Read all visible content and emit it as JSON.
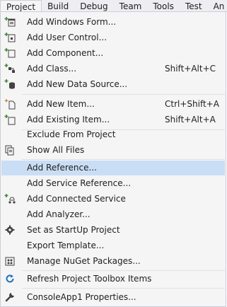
{
  "menubar": {
    "items": [
      {
        "label": "Project"
      },
      {
        "label": "Build"
      },
      {
        "label": "Debug"
      },
      {
        "label": "Team"
      },
      {
        "label": "Tools"
      },
      {
        "label": "Test"
      },
      {
        "label": "An"
      }
    ]
  },
  "menu": {
    "items": [
      {
        "label": "Add Windows Form...",
        "shortcut": "",
        "icon": "add-windows-form-icon"
      },
      {
        "label": "Add User Control...",
        "shortcut": "",
        "icon": "add-user-control-icon"
      },
      {
        "label": "Add Component...",
        "shortcut": "",
        "icon": "add-component-icon"
      },
      {
        "label": "Add Class...",
        "shortcut": "Shift+Alt+C",
        "icon": "add-class-icon"
      },
      {
        "label": "Add New Data Source...",
        "shortcut": "",
        "icon": "add-data-source-icon"
      },
      {
        "label": "Add New Item...",
        "shortcut": "Ctrl+Shift+A",
        "icon": "add-new-item-icon"
      },
      {
        "label": "Add Existing Item...",
        "shortcut": "Shift+Alt+A",
        "icon": "add-existing-item-icon"
      },
      {
        "label": "Exclude From Project",
        "shortcut": "",
        "icon": ""
      },
      {
        "label": "Show All Files",
        "shortcut": "",
        "icon": "show-all-files-icon"
      },
      {
        "label": "Add Reference...",
        "shortcut": "",
        "icon": ""
      },
      {
        "label": "Add Service Reference...",
        "shortcut": "",
        "icon": ""
      },
      {
        "label": "Add Connected Service",
        "shortcut": "",
        "icon": "connected-service-icon"
      },
      {
        "label": "Add Analyzer...",
        "shortcut": "",
        "icon": ""
      },
      {
        "label": "Set as StartUp Project",
        "shortcut": "",
        "icon": "gear-icon"
      },
      {
        "label": "Export Template...",
        "shortcut": "",
        "icon": ""
      },
      {
        "label": "Manage NuGet Packages...",
        "shortcut": "",
        "icon": "nuget-icon"
      },
      {
        "label": "Refresh Project Toolbox Items",
        "shortcut": "",
        "icon": "refresh-icon"
      },
      {
        "label": "ConsoleApp1 Properties...",
        "shortcut": "",
        "icon": "wrench-icon"
      }
    ]
  },
  "colors": {
    "highlight": "#c9def5",
    "menu_background": "#f5f5f5",
    "border": "#cccedb",
    "icon_green": "#388a34",
    "icon_blue": "#1e6fbf",
    "icon_dark": "#424242"
  }
}
